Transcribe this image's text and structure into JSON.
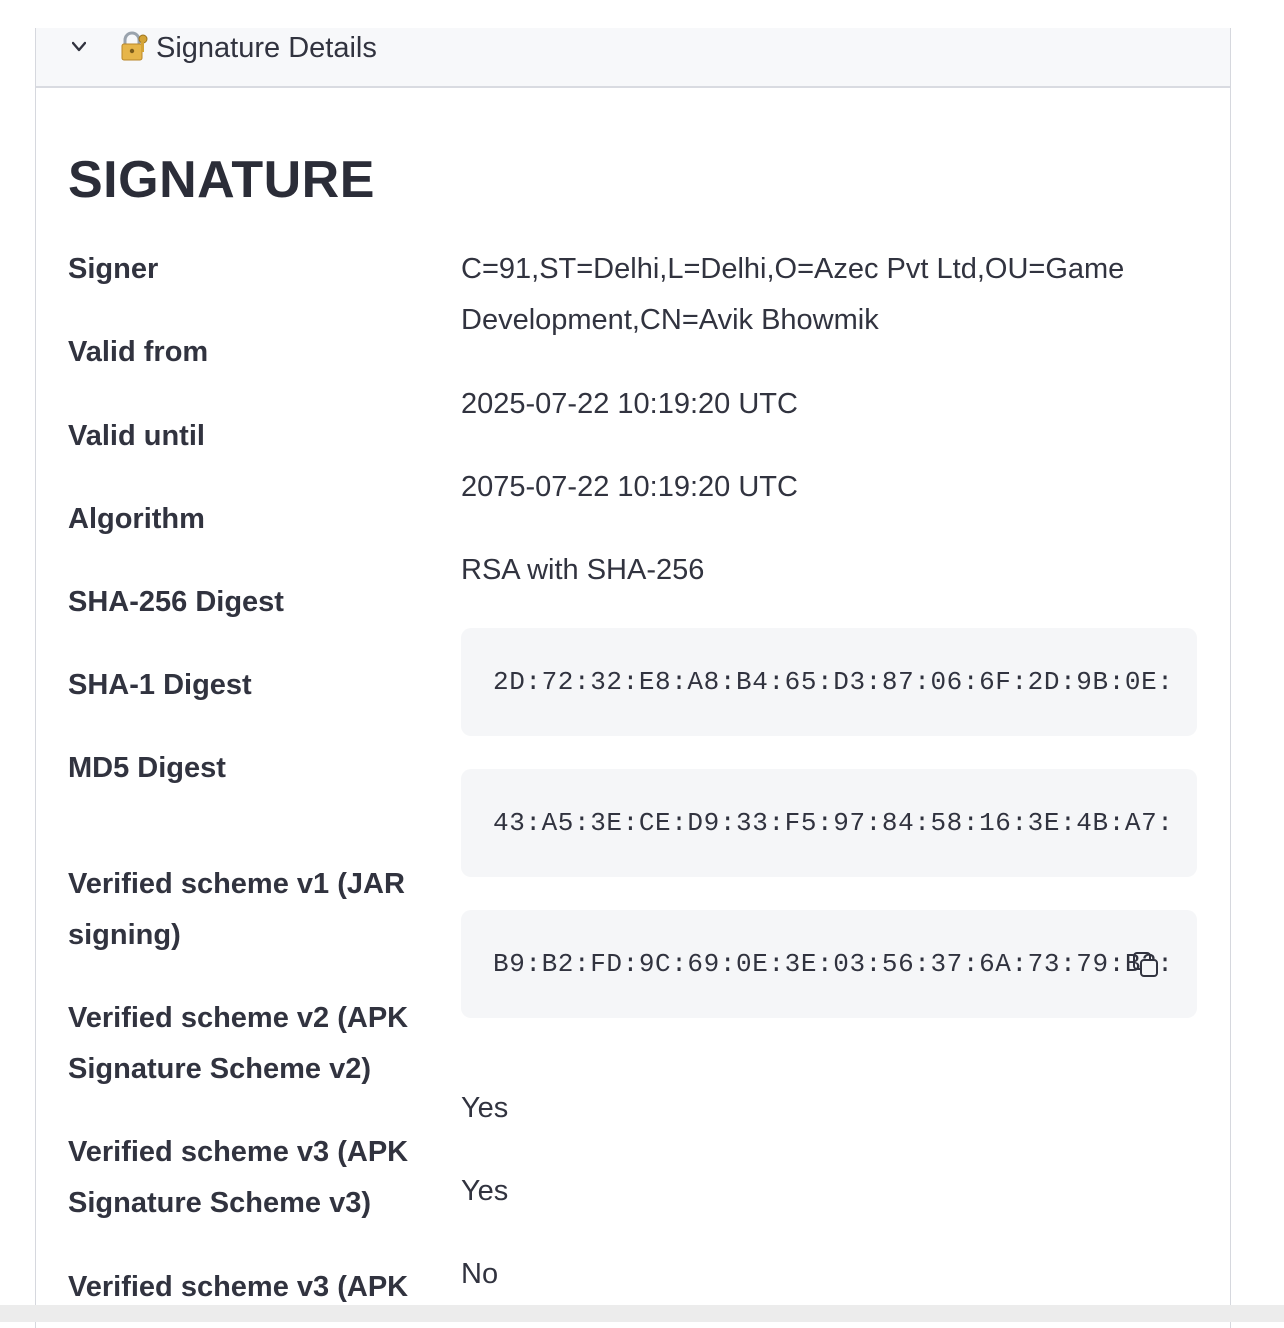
{
  "expander": {
    "title": "Signature Details",
    "icon": "lock-with-key-icon"
  },
  "section": {
    "title": "SIGNATURE"
  },
  "fields": {
    "signer": {
      "label": "Signer",
      "value": "C=91,ST=Delhi,L=Delhi,O=Azec Pvt Ltd,OU=Game Development,CN=Avik Bhowmik"
    },
    "valid_from": {
      "label": "Valid from",
      "value": "2025-07-22 10:19:20 UTC"
    },
    "valid_until": {
      "label": "Valid until",
      "value": "2075-07-22 10:19:20 UTC"
    },
    "algorithm": {
      "label": "Algorithm",
      "value": "RSA with SHA-256"
    },
    "sha256": {
      "label": "SHA-256 Digest",
      "value": "2D:72:32:E8:A8:B4:65:D3:87:06:6F:2D:9B:0E:"
    },
    "sha1": {
      "label": "SHA-1 Digest",
      "value": "43:A5:3E:CE:D9:33:F5:97:84:58:16:3E:4B:A7:"
    },
    "md5": {
      "label": "MD5 Digest",
      "value": "B9:B2:FD:9C:69:0E:3E:03:56:37:6A:73:79:B2:"
    },
    "scheme_v1": {
      "label": "Verified scheme v1 (JAR signing)",
      "value": "Yes"
    },
    "scheme_v2": {
      "label": "Verified scheme v2 (APK Signature Scheme v2)",
      "value": "Yes"
    },
    "scheme_v3": {
      "label": "Verified scheme v3 (APK Signature Scheme v3)",
      "value": "No"
    },
    "scheme_v3_1": {
      "label": "Verified scheme v3 (APK"
    }
  },
  "colors": {
    "text": "#31333f",
    "code_bg": "#f5f6f8",
    "header_bg": "#f7f8fa"
  }
}
